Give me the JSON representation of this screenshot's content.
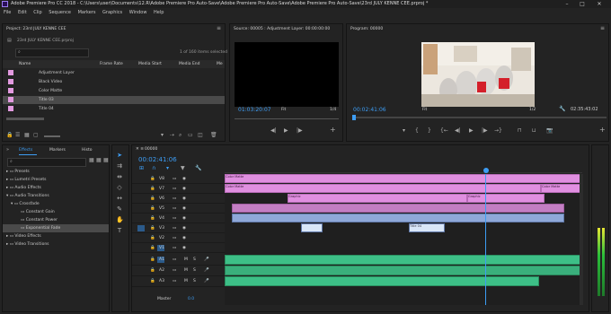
{
  "titlebar": {
    "title": "Adobe Premiere Pro CC 2018 - C:\\Users\\user\\Documents\\12.R\\Adobe Premiere Pro Auto-Save\\Adobe Premiere Pro Auto-Save\\Adobe Premiere Pro Auto-Save\\23rd JULY KENNE CEE.prproj *"
  },
  "menu": [
    "File",
    "Edit",
    "Clip",
    "Sequence",
    "Markers",
    "Graphics",
    "Window",
    "Help"
  ],
  "project": {
    "tab": "Project: 23rd JULY KENNE CEE",
    "filename": "23rd JULY KENNE CEE.prproj",
    "items_selected": "1 of 160 items selected",
    "columns": [
      "Name",
      "Frame Rate",
      "Media Start",
      "Media End",
      "Me"
    ],
    "items": [
      "Adjustment Layer",
      "Black Video",
      "Color Matte",
      "Title 03",
      "Title 04"
    ]
  },
  "source": {
    "tab": "Source: 00005 : Adjustment Layer: 00:00:00:00",
    "timecode": "01:03:20:07",
    "fit": "Fit",
    "scale": "1/4"
  },
  "program": {
    "tab": "Program: 00000",
    "timecode": "00:02:41:06",
    "fit": "Fit",
    "scale": "1/2",
    "duration": "02:35:43:02"
  },
  "effects": {
    "tabs": [
      "Effects",
      "Markers",
      "Histo"
    ],
    "tree": [
      "Presets",
      "Lumetri Presets",
      "Audio Effects",
      "Audio Transitions",
      "Crossfade",
      "Constant Gain",
      "Constant Power",
      "Exponential Fade",
      "Video Effects",
      "Video Transitions"
    ]
  },
  "timeline": {
    "tab": "00000",
    "timecode": "00:02:41:06",
    "tracks_video": [
      "V8",
      "V7",
      "V6",
      "V5",
      "V4",
      "V3",
      "V2",
      "V1"
    ],
    "tracks_audio": [
      "A1",
      "A2",
      "A3"
    ],
    "master": "Master",
    "master_val": "0.0",
    "clip_labels": {
      "color_matte": "Color Matte",
      "graphic": "Graphic",
      "title": "Title 04"
    }
  },
  "colors": {
    "accent": "#3d9df4",
    "pink": "#e08fe0",
    "audio": "#3dbf87"
  }
}
